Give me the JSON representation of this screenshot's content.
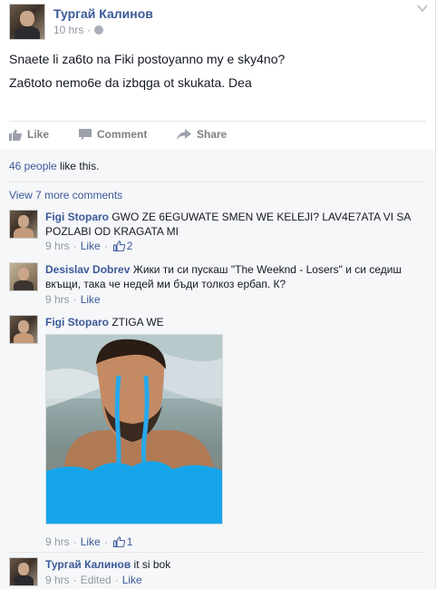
{
  "post": {
    "author": "Тургай Калинов",
    "time": "10 hrs",
    "lines": [
      "Snaete li za6to na Fiki postoyanno my e sky4no?",
      "Za6toto nemo6e da izbqga ot skukata. Dea"
    ],
    "actions": {
      "like": "Like",
      "comment": "Comment",
      "share": "Share"
    }
  },
  "likes": {
    "count_link": "46 people",
    "suffix": " like this."
  },
  "view_more": "View 7 more comments",
  "comments": [
    {
      "author": "Figi Stoparo",
      "text": "GWO ZE 6EGUWATE SMEN WE KELEJI? LAV4E7ATA VI SA POZLABI OD KRAGATA MI",
      "time": "9 hrs",
      "like_label": "Like",
      "like_count": "2"
    },
    {
      "author": "Desislav Dobrev",
      "text": "Жики ти си пускаш \"The Weeknd - Losers\" и си седиш вкъщи, така че недей ми бъди толкоз ербап. К?",
      "time": "9 hrs",
      "like_label": "Like"
    },
    {
      "author": "Figi Stoparo",
      "text": "ZTIGA WE",
      "time": "9 hrs",
      "like_label": "Like",
      "like_count": "1"
    },
    {
      "author": "Тургай Калинов",
      "text": "it si bok",
      "time": "9 hrs",
      "edited": "Edited",
      "like_label": "Like"
    }
  ],
  "colors": {
    "link": "#3b5998",
    "meta": "#9197a3",
    "tears": "#29a8e8"
  },
  "icons": [
    "chevron-down-icon",
    "globe-icon",
    "like-icon",
    "comment-icon",
    "share-icon",
    "thumbs-up-icon"
  ]
}
